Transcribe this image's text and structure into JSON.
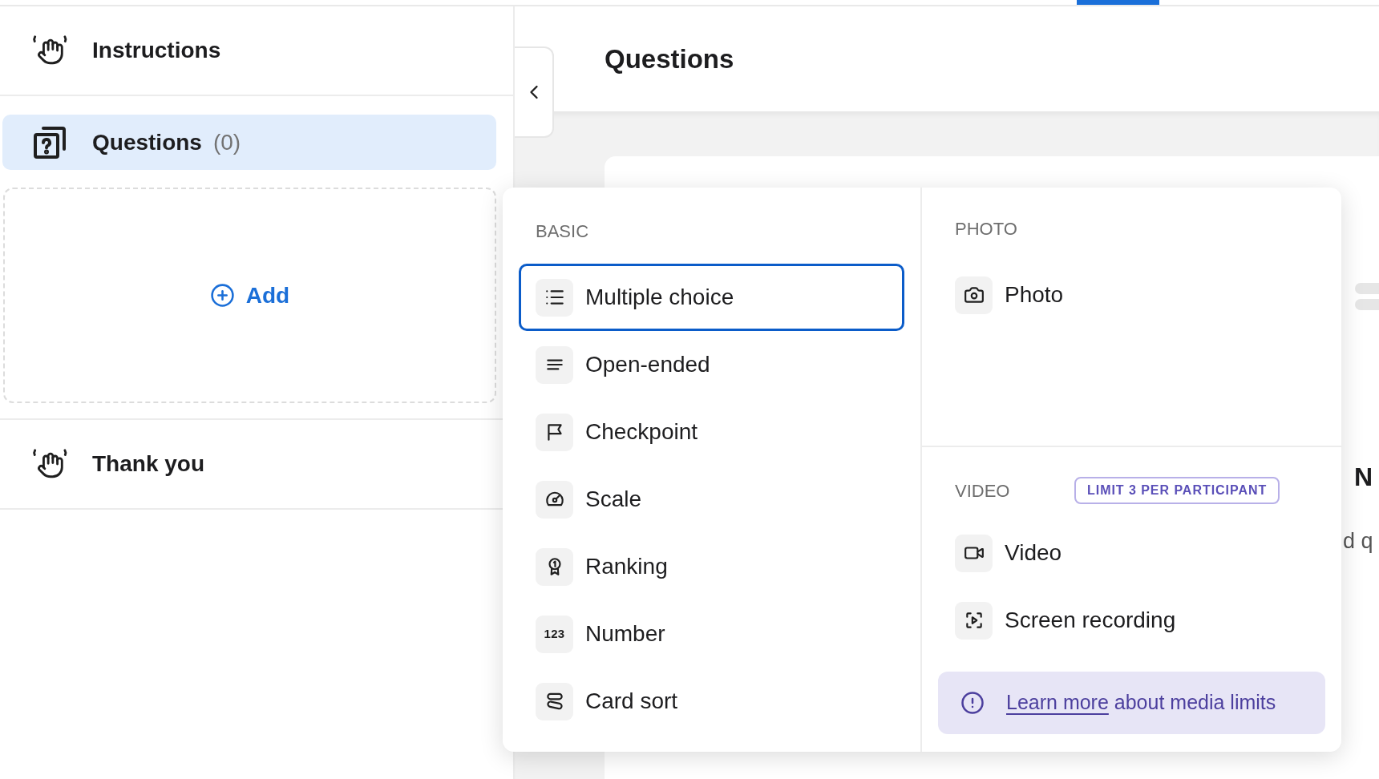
{
  "sidebar": {
    "items": [
      {
        "kind": "step",
        "label": "Instructions",
        "selected": false
      },
      {
        "kind": "group",
        "label": "Questions",
        "count": "(0)",
        "selected": true
      },
      {
        "kind": "add",
        "label": "Add"
      },
      {
        "kind": "step",
        "label": "Thank you",
        "selected": false
      }
    ]
  },
  "main": {
    "title": "Questions",
    "card": {
      "heading": "N",
      "text": "d q"
    }
  },
  "menu": {
    "columns": [
      {
        "sections": [
          {
            "title": "BASIC",
            "items": [
              {
                "kind": "choice",
                "label": "Multiple choice",
                "selected": true
              },
              {
                "kind": "text",
                "label": "Open-ended",
                "selected": false
              },
              {
                "kind": "checkpoint",
                "label": "Checkpoint",
                "selected": false
              },
              {
                "kind": "scale",
                "label": "Scale",
                "selected": false
              },
              {
                "kind": "ranking",
                "label": "Ranking",
                "selected": false
              },
              {
                "kind": "number",
                "label": "Number",
                "icon_text": "123",
                "selected": false
              },
              {
                "kind": "cardsort",
                "label": "Card sort",
                "selected": false
              }
            ]
          }
        ]
      },
      {
        "sections": [
          {
            "title": "PHOTO",
            "items": [
              {
                "kind": "photo",
                "label": "Photo",
                "selected": false
              }
            ]
          },
          {
            "title": "VIDEO",
            "badge": "LIMIT 3 PER PARTICIPANT",
            "items": [
              {
                "kind": "video",
                "label": "Video",
                "selected": false
              },
              {
                "kind": "screen",
                "label": "Screen recording",
                "selected": false
              }
            ],
            "note": {
              "link": "Learn more",
              "text": "about media limits"
            }
          }
        ]
      }
    ]
  }
}
